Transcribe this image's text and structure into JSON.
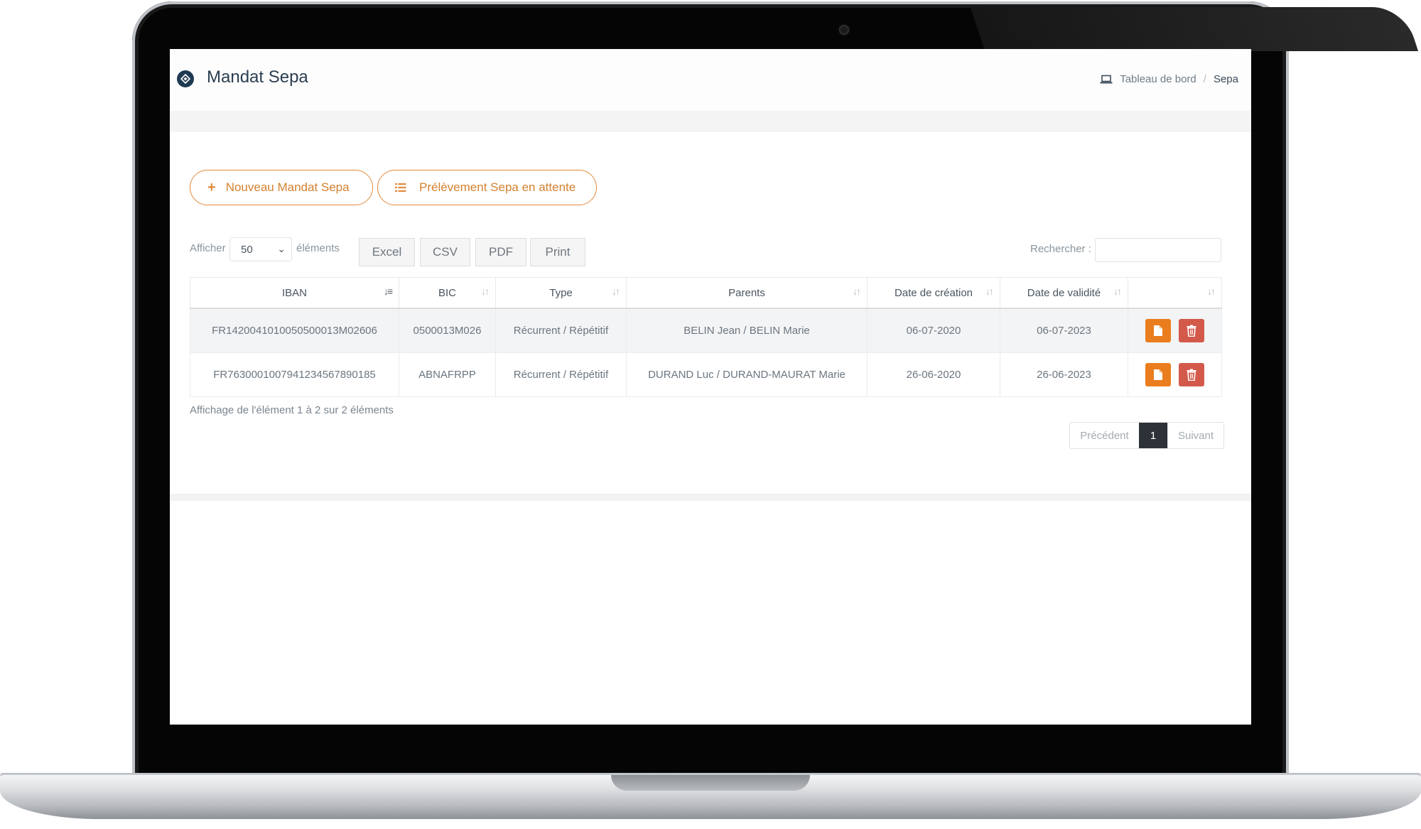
{
  "header": {
    "title": "Mandat Sepa",
    "breadcrumb": {
      "home": "Tableau de bord",
      "separator": "/",
      "current": "Sepa"
    }
  },
  "actions": {
    "new_mandate": "Nouveau Mandat Sepa",
    "pending": "Prélèvement Sepa en attente"
  },
  "toolbar": {
    "show_label": "Afficher",
    "page_size": "50",
    "elements_label": "éléments",
    "exports": [
      "Excel",
      "CSV",
      "PDF",
      "Print"
    ],
    "search_label": "Rechercher :",
    "search_value": ""
  },
  "table": {
    "columns": [
      "IBAN",
      "BIC",
      "Type",
      "Parents",
      "Date de création",
      "Date de validité",
      ""
    ],
    "rows": [
      {
        "iban": "FR1420041010050500013M02606",
        "bic": "0500013M026",
        "type": "Récurrent / Répétitif",
        "parents": "BELIN Jean / BELIN Marie",
        "created": "06-07-2020",
        "valid": "06-07-2023"
      },
      {
        "iban": "FR7630001007941234567890185",
        "bic": "ABNAFRPP",
        "type": "Récurrent / Répétitif",
        "parents": "DURAND Luc / DURAND-MAURAT Marie",
        "created": "26-06-2020",
        "valid": "26-06-2023"
      }
    ]
  },
  "footer": {
    "info": "Affichage de l'élément 1 à 2 sur 2 éléments",
    "prev": "Précédent",
    "page": "1",
    "next": "Suivant"
  },
  "colors": {
    "accent_orange": "#ea7d1d",
    "danger": "#d35a4a",
    "pill_border": "#e08a3c",
    "brand": "#1f3a52"
  }
}
